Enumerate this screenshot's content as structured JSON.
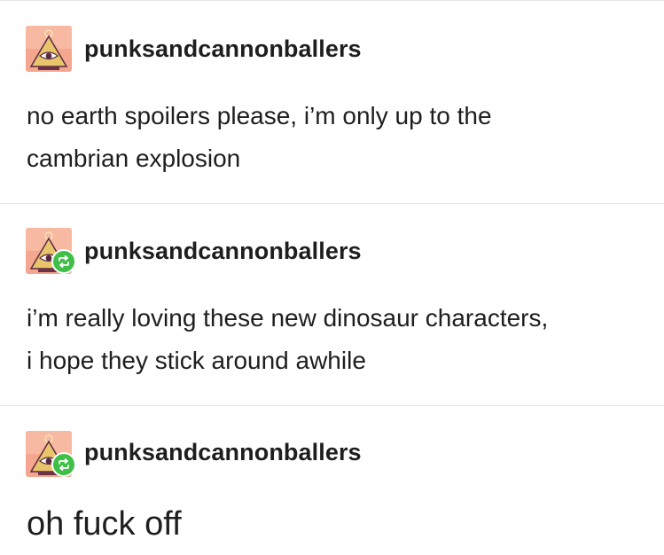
{
  "posts": [
    {
      "username": "punksandcannonballers",
      "text_lines": [
        "no earth spoilers please, i’m only up to the",
        "cambrian explosion"
      ],
      "reblog": false,
      "avatar_icon": "all-seeing-eye-pyramid-icon"
    },
    {
      "username": "punksandcannonballers",
      "text_lines": [
        "i’m really loving these new dinosaur characters,",
        "i hope they stick around awhile"
      ],
      "reblog": true,
      "avatar_icon": "all-seeing-eye-pyramid-icon",
      "badge_icon": "reblog-icon"
    },
    {
      "username": "punksandcannonballers",
      "text": "oh fuck off",
      "reblog": true,
      "avatar_icon": "all-seeing-eye-pyramid-icon",
      "badge_icon": "reblog-icon"
    }
  ],
  "colors": {
    "text": "#1e1e1e",
    "divider": "#e6e6e6",
    "reblog_green": "#3fbf48",
    "avatar_bg": "#f4a68e",
    "avatar_pyramid": "#e8c46a",
    "avatar_eye": "#5a2a44"
  }
}
